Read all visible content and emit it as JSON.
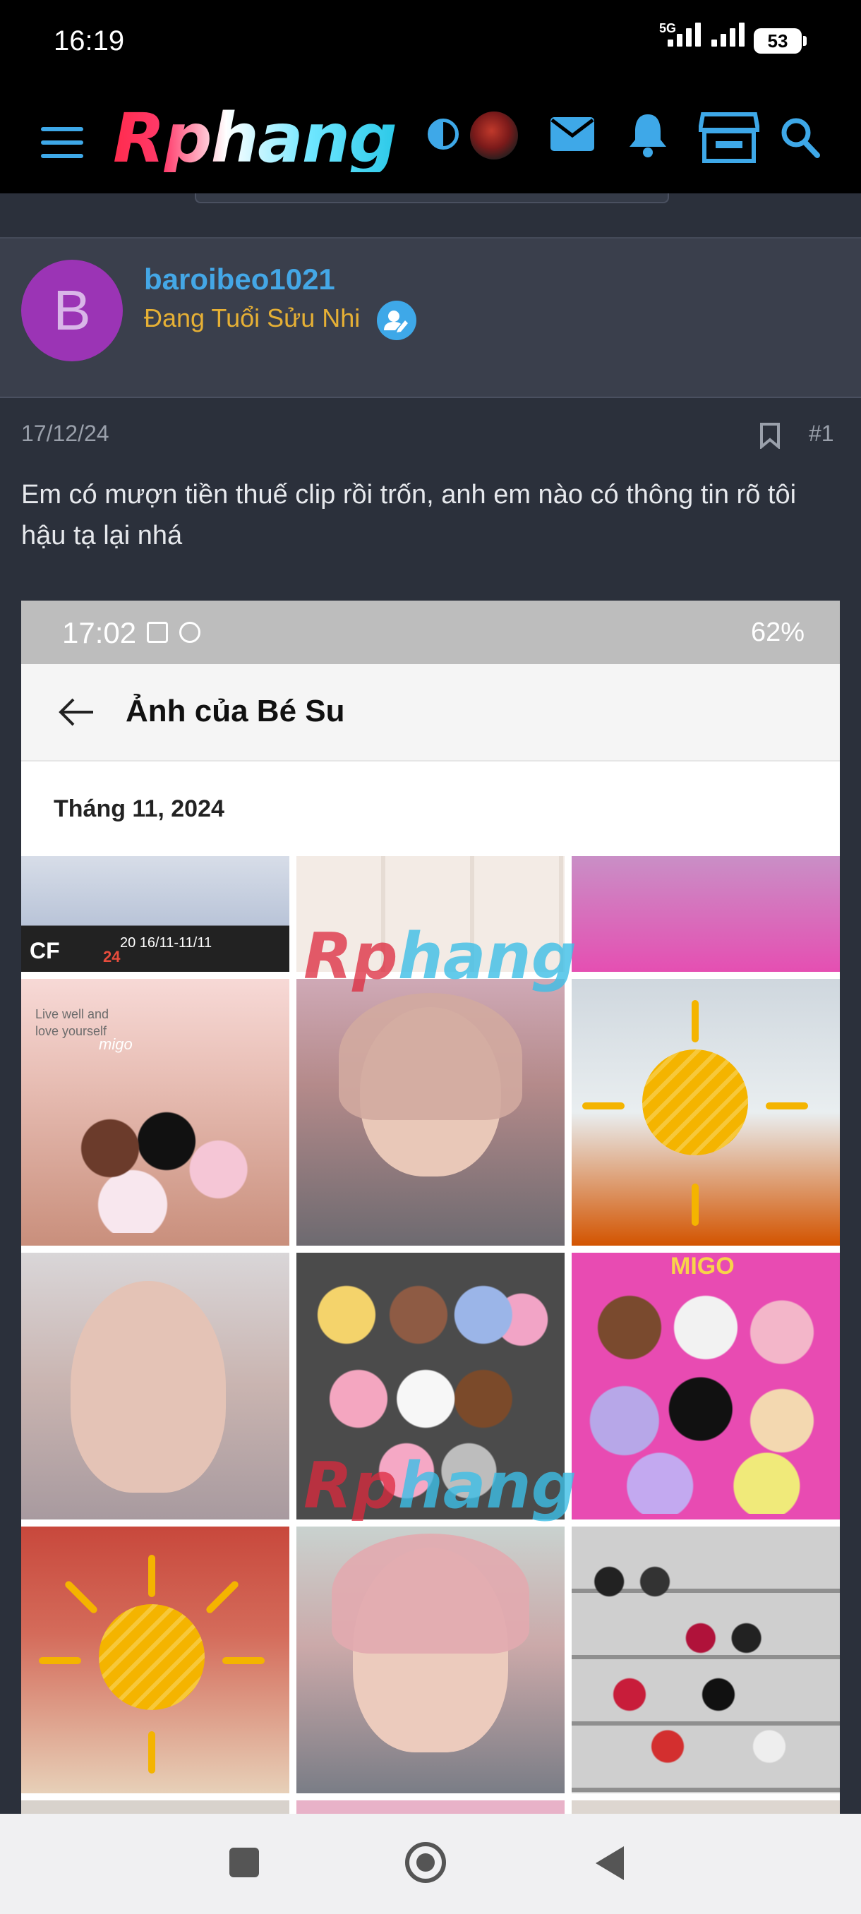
{
  "status_bar": {
    "time": "16:19",
    "network": "5G",
    "battery": "53"
  },
  "header": {
    "logo_text": "Rphang",
    "icons": [
      "menu-icon",
      "theme-toggle-icon",
      "user-avatar",
      "mail-icon",
      "bell-icon",
      "store-icon",
      "search-icon"
    ],
    "accent_color": "#3ea8e8"
  },
  "user": {
    "avatar_letter": "B",
    "avatar_color": "#9b34b5",
    "username": "baroibeo1021",
    "title": "Đang Tuổi Sửu Nhi"
  },
  "post": {
    "date": "17/12/24",
    "number": "#1",
    "text": "Em có mượn tiền thuế clip rồi trốn, anh em nào có thông tin rõ tôi hậu tạ lại nhá"
  },
  "embedded_screenshot": {
    "time": "17:02",
    "battery": "62%",
    "title": "Ảnh của Bé Su",
    "month_label": "Tháng 11, 2024",
    "grid_labels": {
      "event_banner": "20 16/11-11/11",
      "event_banner_num": "24",
      "event_code": "CF",
      "poster_text_1": "Live well and",
      "poster_text_2": "love yourself",
      "poster_brand": "migo",
      "wall_brand": "MIGO"
    }
  },
  "system_nav": {
    "buttons": [
      "recents-button",
      "home-button",
      "back-button"
    ]
  }
}
